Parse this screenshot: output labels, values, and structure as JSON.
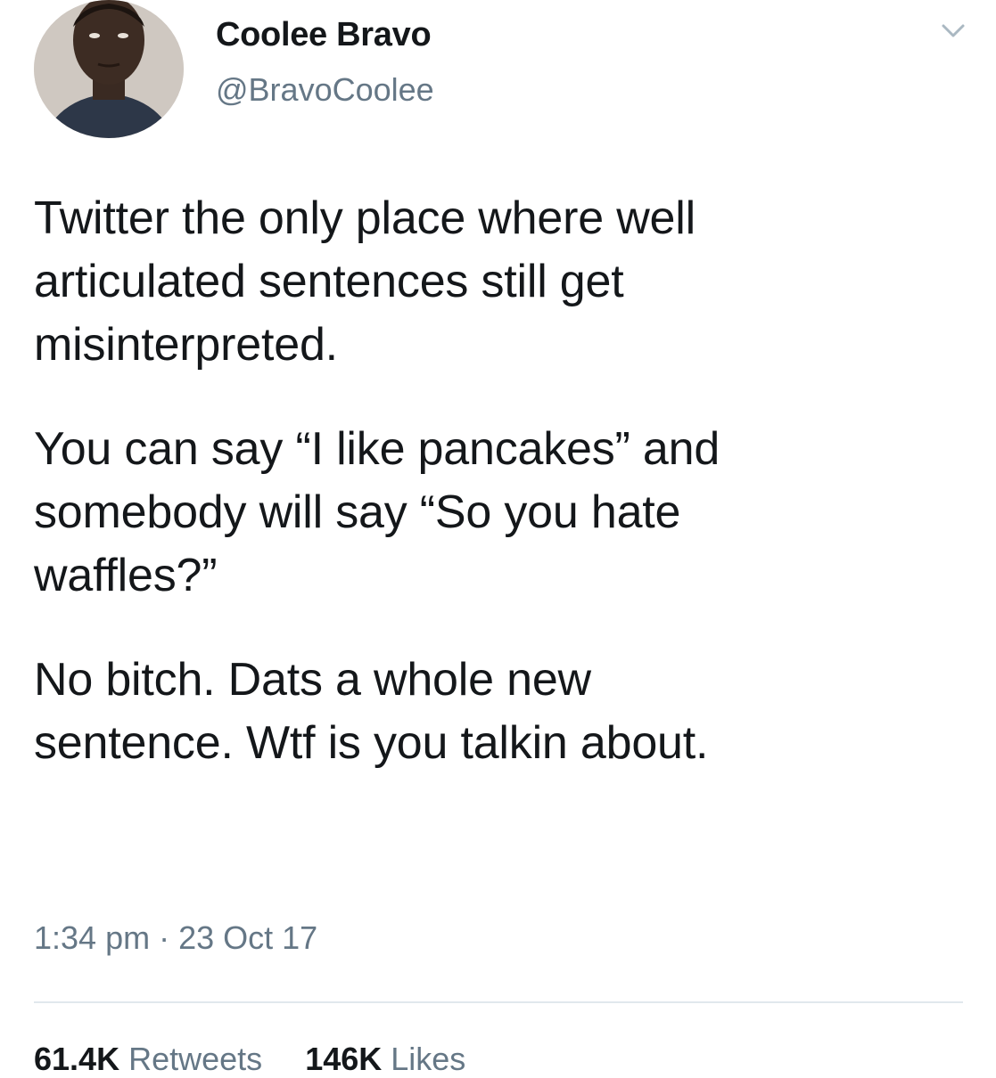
{
  "author": {
    "display_name": "Coolee Bravo",
    "handle": "@BravoCoolee"
  },
  "tweet": {
    "paragraphs": [
      "Twitter the only place where well\narticulated sentences still get\nmisinterpreted.",
      "You can say “I like pancakes” and\nsomebody will say “So you hate\nwaffles?”",
      "No bitch. Dats a whole new\nsentence. Wtf is you talkin about."
    ],
    "time": "1:34 pm",
    "separator": "·",
    "date": "23 Oct 17"
  },
  "stats": {
    "retweets_count": "61.4K",
    "retweets_label": "Retweets",
    "likes_count": "146K",
    "likes_label": "Likes"
  },
  "icons": {
    "caret": "chevron-down-icon"
  },
  "colors": {
    "text": "#14171a",
    "secondary": "#657786",
    "divider": "#e1e8ed"
  }
}
